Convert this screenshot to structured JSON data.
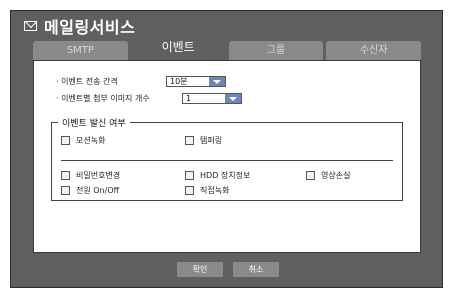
{
  "window": {
    "title": "메일링서비스",
    "tabs": [
      "SMTP",
      "이벤트",
      "그룹",
      "수신자"
    ],
    "active_tab": 1
  },
  "settings": {
    "interval_label": "· 이벤트 전송 간격",
    "interval_value": "10분",
    "attach_label": "· 이벤트별 첨부 이미지 개수",
    "attach_value": "1"
  },
  "event_group": {
    "legend": "이벤트 발신 여부",
    "items": {
      "motion_record": "모션녹화",
      "tampering": "탬퍼링",
      "password_change": "비밀번호변경",
      "hdd_info": "HDD 장치정보",
      "video_loss": "영상손실",
      "power": "전원 On/Off",
      "direct_record": "직접녹화"
    }
  },
  "buttons": {
    "ok": "확인",
    "cancel": "취소"
  }
}
